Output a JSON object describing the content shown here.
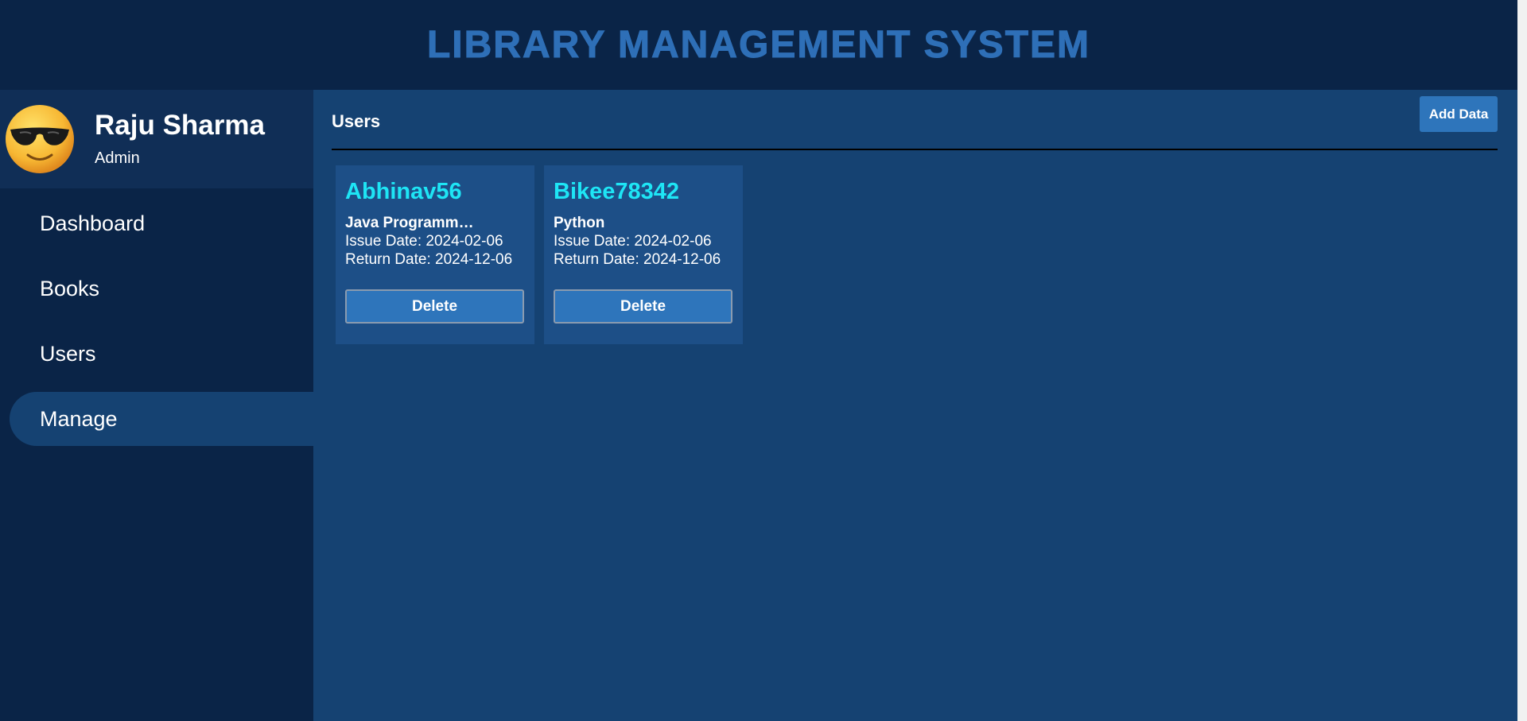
{
  "header": {
    "title": "LIBRARY MANAGEMENT SYSTEM"
  },
  "profile": {
    "avatar_icon": "smiling-face-with-sunglasses-icon",
    "name": "Raju Sharma",
    "role": "Admin"
  },
  "sidebar": {
    "items": [
      {
        "label": "Dashboard",
        "active": false
      },
      {
        "label": "Books",
        "active": false
      },
      {
        "label": "Users",
        "active": false
      },
      {
        "label": "Manage",
        "active": true
      }
    ]
  },
  "main": {
    "title": "Users",
    "add_button_label": "Add Data",
    "cards": [
      {
        "username": "Abhinav56",
        "book": "Java Programm…",
        "issue": "Issue Date: 2024-02-06",
        "return": "Return Date: 2024-12-06",
        "delete_label": "Delete"
      },
      {
        "username": "Bikee78342",
        "book": "Python",
        "issue": "Issue Date: 2024-02-06",
        "return": "Return Date: 2024-12-06",
        "delete_label": "Delete"
      }
    ]
  },
  "colors": {
    "page_bg": "#0a2447",
    "main_bg": "#154272",
    "card_bg": "#1d4f87",
    "accent": "#2e75bb",
    "title_blue": "#2e6fb7",
    "username_cyan": "#1ee5f5"
  }
}
